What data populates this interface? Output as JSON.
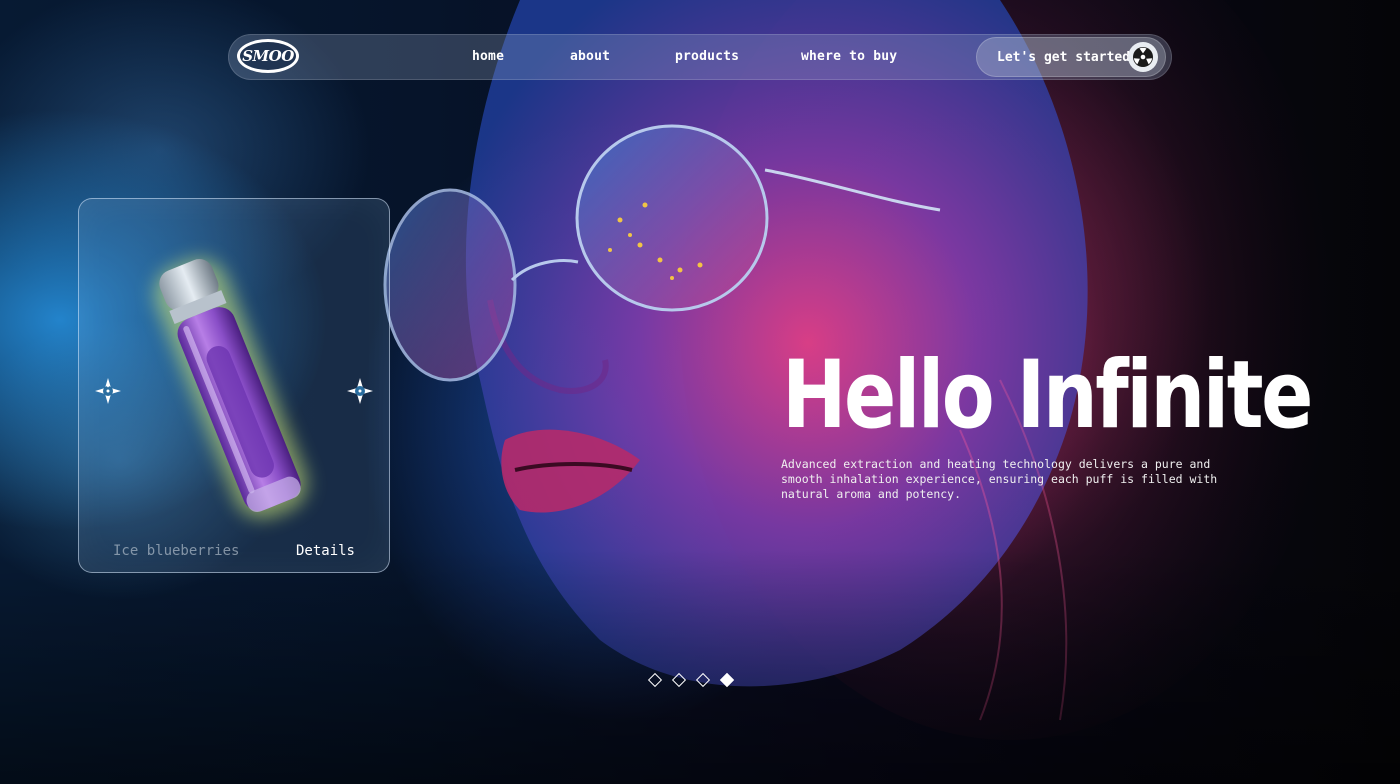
{
  "nav": {
    "logo_text": "SMOO",
    "links": [
      {
        "label": "home"
      },
      {
        "label": "about"
      },
      {
        "label": "products"
      },
      {
        "label": "where to buy"
      }
    ],
    "cta_label": "Let's get started",
    "cta_icon": "radiation-icon"
  },
  "product_card": {
    "flavor": "Ice blueberries",
    "details_label": "Details",
    "prev_icon": "shuriken-left-icon",
    "next_icon": "shuriken-right-icon"
  },
  "hero": {
    "headline": "Hello Infinite",
    "description": "Advanced extraction and heating technology delivers a pure and smooth inhalation experience, ensuring each puff is filled with natural aroma and potency."
  },
  "carousel": {
    "slide_count": 4,
    "active_index": 3
  },
  "colors": {
    "accent_blue": "#1e7be6",
    "accent_pink": "#e6288c",
    "product_purple": "#8a4fc8",
    "product_glow": "#d8f07a"
  }
}
